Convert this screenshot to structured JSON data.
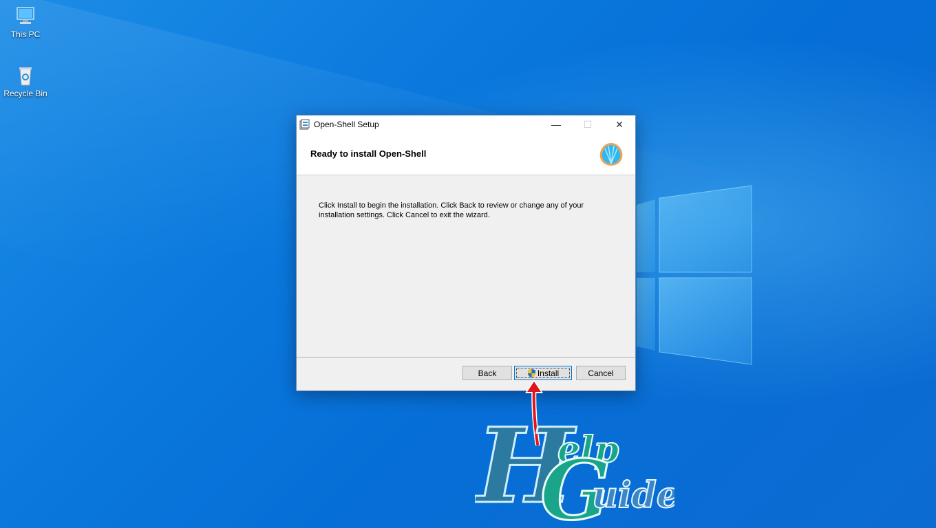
{
  "desktop": {
    "icons": [
      {
        "label": "This PC",
        "icon": "computer-icon"
      },
      {
        "label": "Recycle Bin",
        "icon": "recycle-bin-icon"
      }
    ]
  },
  "dialog": {
    "title": "Open-Shell Setup",
    "heading": "Ready to install Open-Shell",
    "message": "Click Install to begin the installation. Click Back to review or change any of your installation settings. Click Cancel to exit the wizard.",
    "buttons": {
      "back": "Back",
      "install": "Install",
      "cancel": "Cancel"
    },
    "titlebar_controls": {
      "minimize": "—",
      "maximize": "☐",
      "close": "✕"
    }
  },
  "watermark": {
    "text": "HelpGuider"
  },
  "colors": {
    "accent": "#0078d7",
    "annotation": "#e0161b",
    "shell_logo": "#2fb8f0"
  }
}
